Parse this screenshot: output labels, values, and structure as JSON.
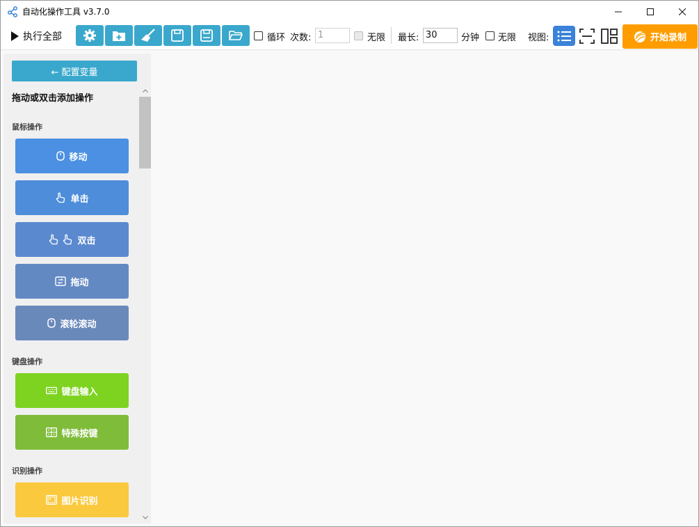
{
  "window": {
    "title": "自动化操作工具 v3.7.0",
    "icon": "share-nodes-icon"
  },
  "toolbar": {
    "run_all_label": "执行全部",
    "icon_buttons": [
      "gear-icon",
      "add-folder-icon",
      "broom-icon",
      "save-icon",
      "save-as-icon",
      "open-folder-icon"
    ],
    "loop_label": "循环",
    "count_label": "次数:",
    "count_value": "1",
    "count_unlimited_label": "无限",
    "max_label": "最长:",
    "max_value": "30",
    "minutes_label": "分钟",
    "max_unlimited_label": "无限",
    "view_label": "视图:",
    "record_label": "开始录制",
    "accent_color": "#3aa8cc",
    "record_color": "#ff9d00"
  },
  "sidebar": {
    "config_label": "← 配置变量",
    "hint": "拖动或双击添加操作",
    "sections": {
      "mouse": "鼠标操作",
      "keyboard": "键盘操作",
      "recognition": "识别操作"
    },
    "mouse_ops": [
      {
        "label": "移动",
        "icon": "mouse-icon",
        "color": "#4b90e2"
      },
      {
        "label": "单击",
        "icon": "pointer-hand-icon",
        "color": "#4d8dd9"
      },
      {
        "label": "双击",
        "icon": "double-hand-icon",
        "color": "#5a89cf"
      },
      {
        "label": "拖动",
        "icon": "drag-icon",
        "color": "#6389c3"
      },
      {
        "label": "滚轮滚动",
        "icon": "scroll-mouse-icon",
        "color": "#6a89bb"
      }
    ],
    "keyboard_ops": [
      {
        "label": "键盘输入",
        "icon": "keyboard-icon",
        "color": "#7ed321"
      },
      {
        "label": "特殊按键",
        "icon": "special-key-icon",
        "color": "#7fbc3a"
      }
    ],
    "recognition_ops": [
      {
        "label": "图片识别",
        "icon": "image-icon",
        "color": "#fbc93d"
      }
    ]
  }
}
